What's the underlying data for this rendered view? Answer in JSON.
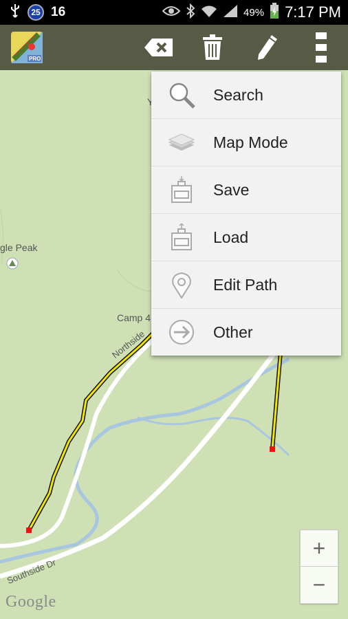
{
  "status_bar": {
    "notification_count": "16",
    "badge_number": "25",
    "battery_percent": "49%",
    "time": "7:17 PM"
  },
  "action_bar": {
    "app_icon_badge": "PRO",
    "actions": [
      "backspace-icon",
      "trash-icon",
      "pencil-icon",
      "overflow-menu-icon"
    ]
  },
  "menu": {
    "items": [
      {
        "label": "Search",
        "icon": "search-icon"
      },
      {
        "label": "Map Mode",
        "icon": "layers-icon"
      },
      {
        "label": "Save",
        "icon": "save-icon"
      },
      {
        "label": "Load",
        "icon": "load-icon"
      },
      {
        "label": "Edit Path",
        "icon": "location-pin-icon"
      },
      {
        "label": "Other",
        "icon": "arrow-circle-icon"
      }
    ]
  },
  "map": {
    "labels": {
      "peak": "gle Peak",
      "camp": "Camp 4",
      "road_north": "Northside",
      "road_south": "Southside Dr",
      "partial_y": "Y"
    },
    "attribution": "Google",
    "colors": {
      "land": "#cfe0b5",
      "road": "#ffffff",
      "river": "#a9c6e0",
      "path": "#f2e600",
      "path_outline": "#111111",
      "marker": "#ee1111"
    }
  },
  "zoom": {
    "plus": "+",
    "minus": "−"
  }
}
